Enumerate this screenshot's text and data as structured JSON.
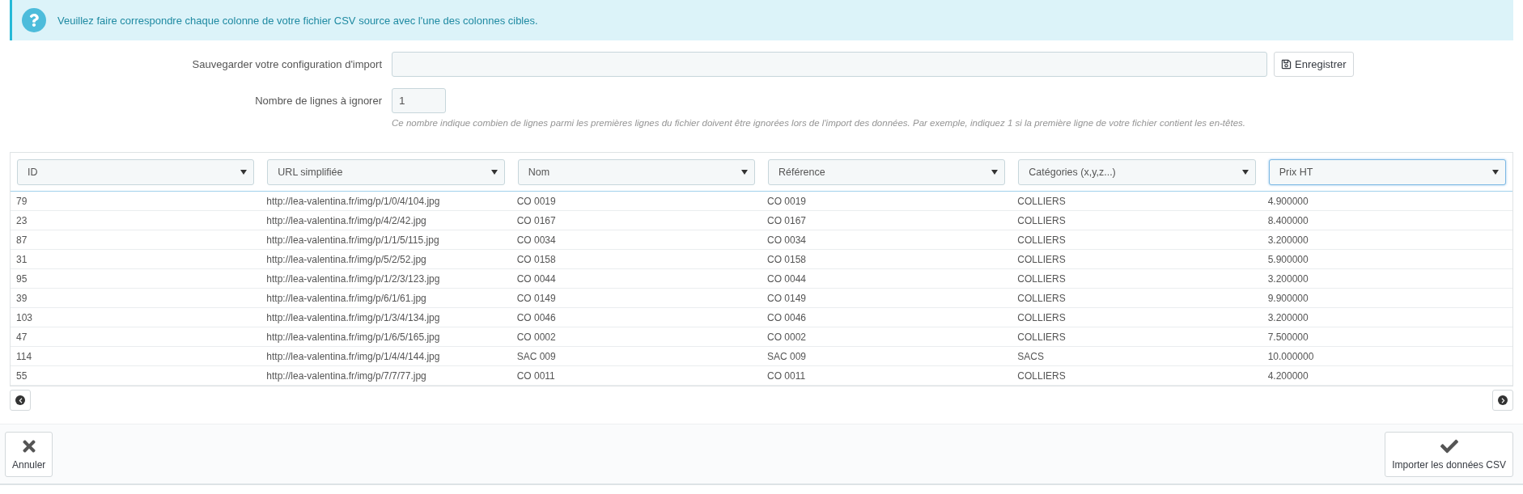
{
  "alert": {
    "text": "Veuillez faire correspondre chaque colonne de votre fichier CSV source avec l'une des colonnes cibles."
  },
  "form": {
    "save_config": {
      "label": "Sauvegarder votre configuration d'import",
      "button": "Enregistrer"
    },
    "skip_lines": {
      "label": "Nombre de lignes à ignorer",
      "value": "1",
      "help": "Ce nombre indique combien de lignes parmi les premières lignes du fichier doivent être ignorées lors de l'import des données. Par exemple, indiquez 1 si la première ligne de votre fichier contient les en-têtes."
    }
  },
  "table": {
    "columns": [
      {
        "label": "ID",
        "focused": false
      },
      {
        "label": "URL simplifiée",
        "focused": false
      },
      {
        "label": "Nom",
        "focused": false
      },
      {
        "label": "Référence",
        "focused": false
      },
      {
        "label": "Catégories (x,y,z...)",
        "focused": false
      },
      {
        "label": "Prix HT",
        "focused": true
      }
    ],
    "rows": [
      [
        "79",
        "http://lea-valentina.fr/img/p/1/0/4/104.jpg",
        "CO 0019",
        "CO 0019",
        "COLLIERS",
        "4.900000"
      ],
      [
        "23",
        "http://lea-valentina.fr/img/p/4/2/42.jpg",
        "CO 0167",
        "CO 0167",
        "COLLIERS",
        "8.400000"
      ],
      [
        "87",
        "http://lea-valentina.fr/img/p/1/1/5/115.jpg",
        "CO 0034",
        "CO 0034",
        "COLLIERS",
        "3.200000"
      ],
      [
        "31",
        "http://lea-valentina.fr/img/p/5/2/52.jpg",
        "CO 0158",
        "CO 0158",
        "COLLIERS",
        "5.900000"
      ],
      [
        "95",
        "http://lea-valentina.fr/img/p/1/2/3/123.jpg",
        "CO 0044",
        "CO 0044",
        "COLLIERS",
        "3.200000"
      ],
      [
        "39",
        "http://lea-valentina.fr/img/p/6/1/61.jpg",
        "CO 0149",
        "CO 0149",
        "COLLIERS",
        "9.900000"
      ],
      [
        "103",
        "http://lea-valentina.fr/img/p/1/3/4/134.jpg",
        "CO 0046",
        "CO 0046",
        "COLLIERS",
        "3.200000"
      ],
      [
        "47",
        "http://lea-valentina.fr/img/p/1/6/5/165.jpg",
        "CO 0002",
        "CO 0002",
        "COLLIERS",
        "7.500000"
      ],
      [
        "114",
        "http://lea-valentina.fr/img/p/1/4/4/144.jpg",
        "SAC 009",
        "SAC 009",
        "SACS",
        "10.000000"
      ],
      [
        "55",
        "http://lea-valentina.fr/img/p/7/7/77.jpg",
        "CO 0011",
        "CO 0011",
        "COLLIERS",
        "4.200000"
      ]
    ]
  },
  "footer": {
    "cancel": "Annuler",
    "submit": "Importer les données CSV"
  }
}
